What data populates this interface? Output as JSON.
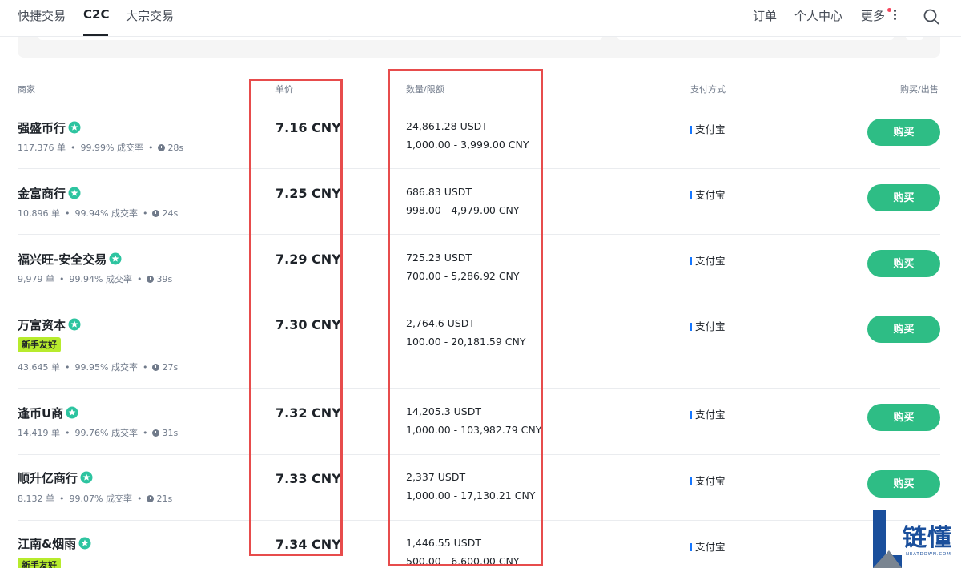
{
  "nav": {
    "tabs": [
      "快捷交易",
      "C2C",
      "大宗交易"
    ],
    "active_tab": "C2C",
    "right_items": {
      "orders": "订单",
      "profile": "个人中心",
      "more": "更多"
    }
  },
  "table": {
    "headers": {
      "merchant": "商家",
      "price": "单价",
      "amount_limit": "数量/限额",
      "payment": "支付方式",
      "action": "购买/出售"
    },
    "rows": [
      {
        "name": "强盛币行",
        "badge": "",
        "orders": "117,376 单",
        "rate": "99.99% 成交率",
        "time": "28s",
        "price": "7.16 CNY",
        "amount": "24,861.28 USDT",
        "limit": "1,000.00 - 3,999.00 CNY",
        "payment": "支付宝",
        "button": "购买"
      },
      {
        "name": "金富商行",
        "badge": "",
        "orders": "10,896 单",
        "rate": "99.94% 成交率",
        "time": "24s",
        "price": "7.25 CNY",
        "amount": "686.83 USDT",
        "limit": "998.00 - 4,979.00 CNY",
        "payment": "支付宝",
        "button": "购买"
      },
      {
        "name": "福兴旺-安全交易",
        "badge": "",
        "orders": "9,979 单",
        "rate": "99.94% 成交率",
        "time": "39s",
        "price": "7.29 CNY",
        "amount": "725.23 USDT",
        "limit": "700.00 - 5,286.92 CNY",
        "payment": "支付宝",
        "button": "购买"
      },
      {
        "name": "万富资本",
        "badge": "新手友好",
        "orders": "43,645 单",
        "rate": "99.95% 成交率",
        "time": "27s",
        "price": "7.30 CNY",
        "amount": "2,764.6 USDT",
        "limit": "100.00 - 20,181.59 CNY",
        "payment": "支付宝",
        "button": "购买"
      },
      {
        "name": "逢币U商",
        "badge": "",
        "orders": "14,419 单",
        "rate": "99.76% 成交率",
        "time": "31s",
        "price": "7.32 CNY",
        "amount": "14,205.3 USDT",
        "limit": "1,000.00 - 103,982.79 CNY",
        "payment": "支付宝",
        "button": "购买"
      },
      {
        "name": "顺升亿商行",
        "badge": "",
        "orders": "8,132 单",
        "rate": "99.07% 成交率",
        "time": "21s",
        "price": "7.33 CNY",
        "amount": "2,337 USDT",
        "limit": "1,000.00 - 17,130.21 CNY",
        "payment": "支付宝",
        "button": "购买"
      },
      {
        "name": "江南&烟雨",
        "badge": "新手友好",
        "orders": "",
        "rate": "",
        "time": "",
        "price": "7.34 CNY",
        "amount": "1,446.55 USDT",
        "limit": "500.00 - 6,600.00 CNY",
        "payment": "支付宝",
        "button": ""
      }
    ]
  },
  "watermark": {
    "text": "链懂",
    "subtext": "NEATDOWN.COM"
  },
  "colors": {
    "buy_green": "#2ebd85",
    "annotation_red": "#e74c4c",
    "badge_lime": "#b7eb2d",
    "verify_teal": "#2dc4a0"
  }
}
